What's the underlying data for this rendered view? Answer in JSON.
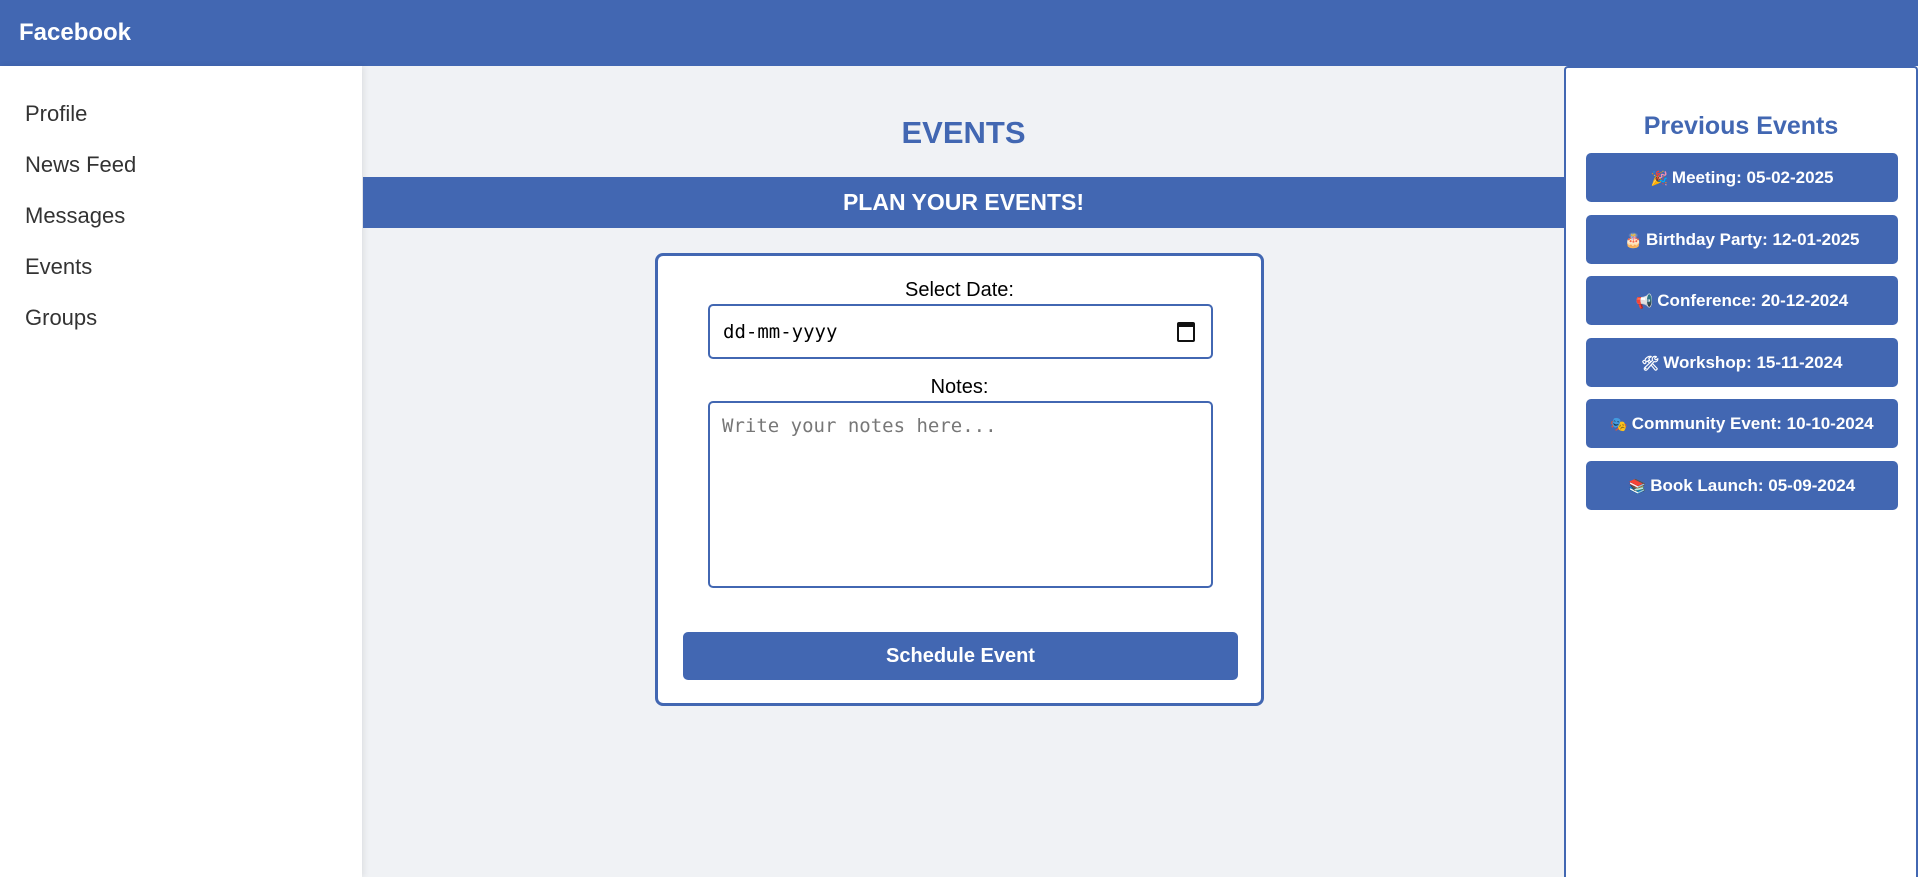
{
  "header": {
    "brand": "Facebook"
  },
  "sidebar": {
    "items": [
      {
        "label": "Profile"
      },
      {
        "label": "News Feed"
      },
      {
        "label": "Messages"
      },
      {
        "label": "Events"
      },
      {
        "label": "Groups"
      }
    ]
  },
  "main": {
    "title": "EVENTS",
    "banner": "PLAN YOUR EVENTS!",
    "form": {
      "date_label": "Select Date:",
      "date_value": "dd-mm-yyyy",
      "notes_label": "Notes:",
      "notes_placeholder": "Write your notes here...",
      "submit_label": "Schedule Event"
    }
  },
  "previous_events": {
    "title": "Previous Events",
    "items": [
      {
        "icon": "🎉",
        "icon_name": "party-popper-icon",
        "label": "Meeting: 05-02-2025"
      },
      {
        "icon": "🎂",
        "icon_name": "birthday-cake-icon",
        "label": "Birthday Party: 12-01-2025"
      },
      {
        "icon": "📢",
        "icon_name": "megaphone-icon",
        "label": "Conference: 20-12-2024"
      },
      {
        "icon": "🛠",
        "icon_name": "tools-icon",
        "label": "Workshop: 15-11-2024"
      },
      {
        "icon": "🎭",
        "icon_name": "theater-masks-icon",
        "label": "Community Event: 10-10-2024"
      },
      {
        "icon": "📚",
        "icon_name": "books-icon",
        "label": "Book Launch: 05-09-2024"
      }
    ]
  },
  "colors": {
    "brand": "#4267b2",
    "background": "#f0f2f5"
  }
}
